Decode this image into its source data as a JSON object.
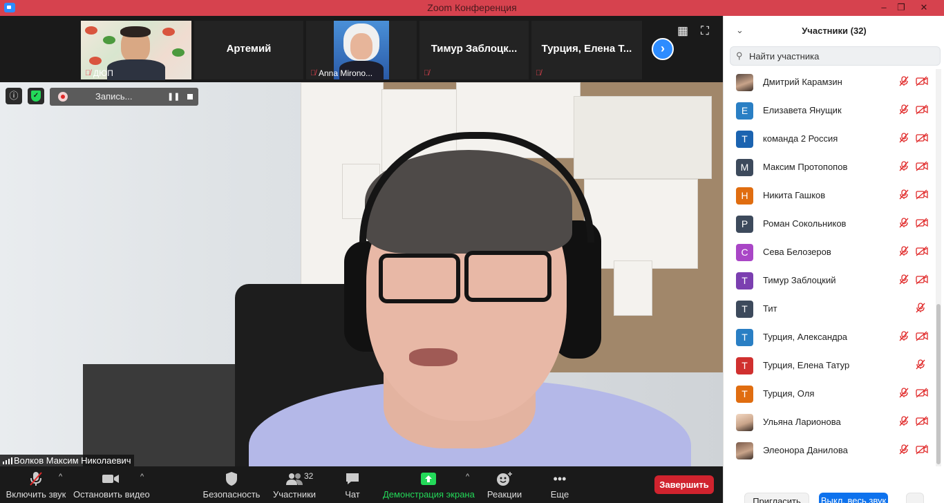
{
  "window": {
    "title": "Zoom Конференция",
    "controls": [
      "–",
      "❐",
      "✕"
    ]
  },
  "strip": {
    "thumbnails": [
      {
        "caption": "ДЮП",
        "type": "video"
      },
      {
        "caption": "Артемий",
        "type": "name"
      },
      {
        "caption": "Anna Mirono...",
        "type": "video"
      },
      {
        "caption": "Тимур  Заблоцк...",
        "type": "name"
      },
      {
        "caption": "Турция, Елена Т...",
        "type": "name"
      }
    ],
    "icons": {
      "grid": "grid-view-icon",
      "fullscreen": "fullscreen-icon",
      "next": "next-page-icon"
    }
  },
  "main": {
    "recording_label": "Запись...",
    "speaker_name": "Волков Максим Николаевич"
  },
  "toolbar": {
    "unmute": "Включить звук",
    "stop_video": "Остановить видео",
    "security": "Безопасность",
    "participants": "Участники",
    "participants_count": "32",
    "chat": "Чат",
    "share": "Демонстрация экрана",
    "reactions": "Реакции",
    "more": "Еще",
    "end": "Завершить",
    "share_color": "#23d959"
  },
  "panel": {
    "title": "Участники (32)",
    "search_placeholder": "Найти участника",
    "participants": [
      {
        "name": "Дмитрий Карамзин",
        "initial": "",
        "color": "#5a4a42",
        "photo": true,
        "video_off": true
      },
      {
        "name": "Елизавета Янущик",
        "initial": "Е",
        "color": "#2a7fc4",
        "photo": false,
        "video_off": true
      },
      {
        "name": "команда 2 Россия",
        "initial": "Т",
        "color": "#1b63b0",
        "photo": false,
        "video_off": true
      },
      {
        "name": "Максим Протопопов",
        "initial": "М",
        "color": "#3d4a5c",
        "photo": false,
        "video_off": true
      },
      {
        "name": "Никита Гашков",
        "initial": "Н",
        "color": "#e06d10",
        "photo": false,
        "video_off": true
      },
      {
        "name": "Роман Сокольников",
        "initial": "Р",
        "color": "#3d4a5c",
        "photo": false,
        "video_off": true
      },
      {
        "name": "Сева Белозеров",
        "initial": "С",
        "color": "#a946c6",
        "photo": false,
        "video_off": true
      },
      {
        "name": "Тимур Заблоцкий",
        "initial": "Т",
        "color": "#7b3fb0",
        "photo": false,
        "video_off": true
      },
      {
        "name": "Тит",
        "initial": "Т",
        "color": "#3d4a5c",
        "photo": false,
        "video_off": false
      },
      {
        "name": "Турция, Александра",
        "initial": "Т",
        "color": "#2a7fc4",
        "photo": false,
        "video_off": true
      },
      {
        "name": "Турция, Елена Татур",
        "initial": "Т",
        "color": "#d0302f",
        "photo": false,
        "video_off": false
      },
      {
        "name": "Турция, Оля",
        "initial": "Т",
        "color": "#e06d10",
        "photo": false,
        "video_off": true
      },
      {
        "name": "Ульяна Ларионова",
        "initial": "",
        "color": "#f3d8c2",
        "photo": true,
        "video_off": true
      },
      {
        "name": "Элеонора Данилова",
        "initial": "",
        "color": "#7a5a4a",
        "photo": true,
        "video_off": true
      }
    ],
    "invite": "Пригласить",
    "mute_all": "Выкл. весь звук",
    "more": "..."
  }
}
